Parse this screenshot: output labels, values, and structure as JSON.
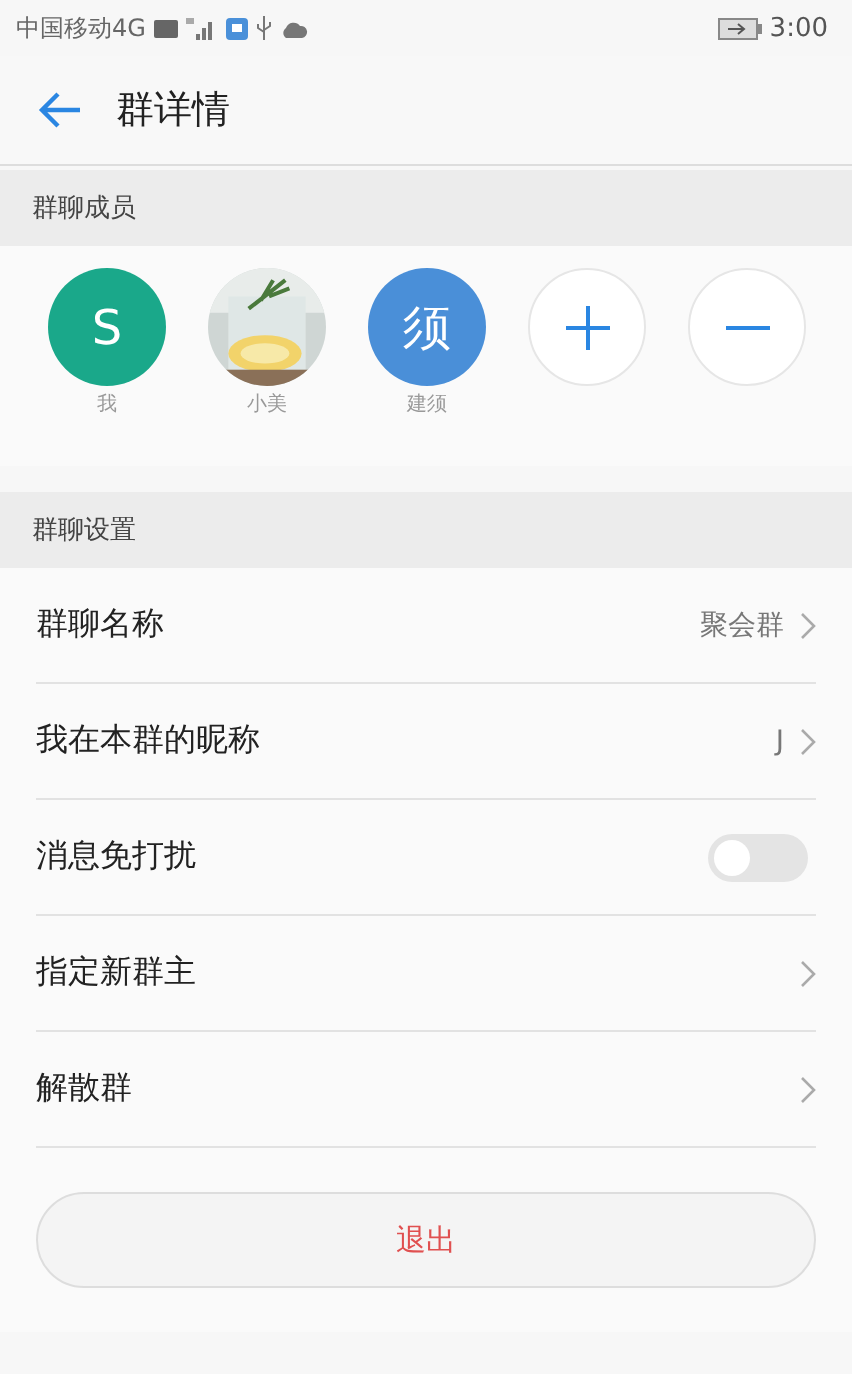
{
  "status_bar": {
    "carrier": "中国移动4G",
    "time": "3:00"
  },
  "header": {
    "title": "群详情"
  },
  "members_section": {
    "title": "群聊成员",
    "members": [
      {
        "kind": "letter",
        "avatar_text": "S",
        "color": "#1aa88a",
        "name": "我"
      },
      {
        "kind": "picture",
        "name": "小美"
      },
      {
        "kind": "letter",
        "avatar_text": "须",
        "color": "#4a8fd8",
        "name": "建须"
      }
    ]
  },
  "settings_section": {
    "title": "群聊设置",
    "rows": [
      {
        "kind": "value",
        "label": "群聊名称",
        "value": "聚会群"
      },
      {
        "kind": "value",
        "label": "我在本群的昵称",
        "value": "J"
      },
      {
        "kind": "toggle",
        "label": "消息免打扰",
        "on": false
      },
      {
        "kind": "value",
        "label": "指定新群主"
      },
      {
        "kind": "value",
        "label": "解散群"
      }
    ]
  },
  "exit_button": "退出"
}
